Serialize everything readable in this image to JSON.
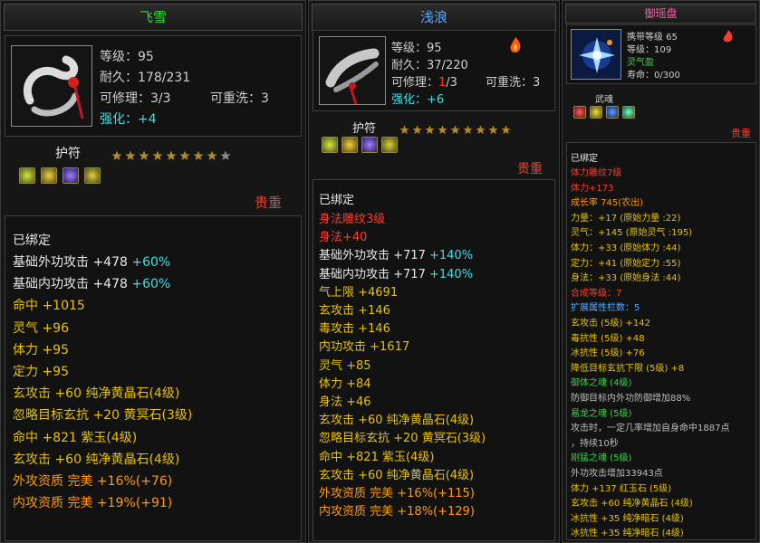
{
  "panel1": {
    "title": "飞雪",
    "level": "等级：95",
    "durability": "耐久：178/231",
    "repair": "可修理：3/3",
    "rewash": "可重洗：3",
    "strengthen_label": "强化：",
    "strengthen_value": "+4",
    "amulet_label": "护符",
    "rarity": "贵重",
    "bound": "已绑定",
    "stats": [
      {
        "text": "基础外功攻击 +478 ",
        "extra": "+60%",
        "color": "white"
      },
      {
        "text": "基础内功攻击 +478 ",
        "extra": "+60%",
        "color": "white"
      },
      {
        "text": "命中 +1015",
        "extra": "",
        "color": "gold"
      },
      {
        "text": "灵气 +96",
        "extra": "",
        "color": "gold"
      },
      {
        "text": "体力 +95",
        "extra": "",
        "color": "gold"
      },
      {
        "text": "定力 +95",
        "extra": "",
        "color": "gold"
      },
      {
        "text": "玄攻击 +60 纯净黄晶石(4级)",
        "extra": "",
        "color": "gold"
      },
      {
        "text": "忽略目标玄抗 +20 黄冥石(3级)",
        "extra": "",
        "color": "gold"
      },
      {
        "text": "命中 +821 紫玉(4级)",
        "extra": "",
        "color": "gold"
      },
      {
        "text": "玄攻击 +60 纯净黄晶石(4级)",
        "extra": "",
        "color": "gold"
      },
      {
        "text": "外攻资质  完美 +16%(+76)",
        "extra": "",
        "color": "orange"
      },
      {
        "text": "内攻资质  完美 +19%(+91)",
        "extra": "",
        "color": "orange"
      }
    ]
  },
  "panel2": {
    "title": "浅浪",
    "level": "等级：95",
    "durability_prefix": "耐久：",
    "durability_value": "37/220",
    "repair_prefix": "可修理：",
    "repair_value": "1",
    "repair_suffix": "/3",
    "rewash": "可重洗：3",
    "strengthen_label": "强化：",
    "strengthen_value": "+6",
    "amulet_label": "护符",
    "rarity": "贵重",
    "bound": "已绑定",
    "stats": [
      {
        "text": "身法雕纹3级",
        "extra": "",
        "color": "red"
      },
      {
        "text": "身法+40",
        "extra": "",
        "color": "red"
      },
      {
        "text": "基础外功攻击 +717 ",
        "extra": "+140%",
        "color": "white"
      },
      {
        "text": "基础内功攻击 +717 ",
        "extra": "+140%",
        "color": "white"
      },
      {
        "text": "气上限 +4691",
        "extra": "",
        "color": "gold"
      },
      {
        "text": "玄攻击 +146",
        "extra": "",
        "color": "gold"
      },
      {
        "text": "毒攻击 +146",
        "extra": "",
        "color": "gold"
      },
      {
        "text": "内功攻击 +1617",
        "extra": "",
        "color": "gold"
      },
      {
        "text": "灵气 +85",
        "extra": "",
        "color": "gold"
      },
      {
        "text": "体力 +84",
        "extra": "",
        "color": "gold"
      },
      {
        "text": "身法 +46",
        "extra": "",
        "color": "gold"
      },
      {
        "text": "玄攻击 +60 纯净黄晶石(4级)",
        "extra": "",
        "color": "gold"
      },
      {
        "text": "忽略目标玄抗 +20 黄冥石(3级)",
        "extra": "",
        "color": "gold"
      },
      {
        "text": "命中 +821 紫玉(4级)",
        "extra": "",
        "color": "gold"
      },
      {
        "text": "玄攻击 +60 纯净黄晶石(4级)",
        "extra": "",
        "color": "gold"
      },
      {
        "text": "外攻资质  完美 +16%(+115)",
        "extra": "",
        "color": "orange"
      },
      {
        "text": "内攻资质  完美 +18%(+129)",
        "extra": "",
        "color": "orange"
      }
    ]
  },
  "panel3": {
    "title": "御瑶盘",
    "carry_level": "携带等级 65",
    "level": "等级：109",
    "spirit": "灵气盈",
    "life": "寿命：0/300",
    "soul_label": "武魂",
    "rarity": "贵重",
    "bound": "已绑定",
    "stats": [
      {
        "text": "体力雕纹7级",
        "color": "red"
      },
      {
        "text": "体力+173",
        "color": "red"
      },
      {
        "text": "成长率 745(农出)",
        "color": "orange"
      },
      {
        "text": "力量：+17 (原始力量 :22)",
        "color": "gold"
      },
      {
        "text": "灵气：+145 (原始灵气 :195)",
        "color": "gold"
      },
      {
        "text": "体力：+33 (原始体力 :44)",
        "color": "gold"
      },
      {
        "text": "定力：+41 (原始定力 :55)",
        "color": "gold"
      },
      {
        "text": "身法：+33 (原始身法 :44)",
        "color": "gold"
      },
      {
        "text": "合成等级：7",
        "color": "red"
      },
      {
        "text": "扩展属性栏数：5",
        "color": "blue"
      },
      {
        "text": "玄攻击 (5级) +142",
        "color": "gold"
      },
      {
        "text": "毒抗性 (5级) +48",
        "color": "gold"
      },
      {
        "text": "冰抗性 (5级) +76",
        "color": "gold"
      },
      {
        "text": "降低目标玄抗下限 (5级) +8",
        "color": "gold"
      },
      {
        "text": "御体之魂 (4级)",
        "color": "green"
      },
      {
        "text": "防御目标内外功防御增加88%",
        "color": "gray"
      },
      {
        "text": "易龙之魂 (5级)",
        "color": "green"
      },
      {
        "text": "攻击时，一定几率增加自身命中1887点",
        "color": "gray"
      },
      {
        "text": "，持续10秒",
        "color": "gray"
      },
      {
        "text": "刚猛之魂 (5级)",
        "color": "green"
      },
      {
        "text": "外功攻击增加33943点",
        "color": "gray"
      },
      {
        "text": "体力 +137 红玉石 (5级)",
        "color": "gold"
      },
      {
        "text": "玄攻击 +60 纯净黄晶石 (4级)",
        "color": "gold"
      },
      {
        "text": "冰抗性 +35 纯净暗石 (4级)",
        "color": "gold"
      },
      {
        "text": "冰抗性 +35 纯净暗石 (4级)",
        "color": "gold"
      }
    ]
  },
  "colors": {
    "gold": "#e6c200",
    "white": "#e8e8e8",
    "cyan": "#3ee0e0",
    "red": "#ff3a2a",
    "orange": "#ff9a00",
    "green": "#3fd14a",
    "blue": "#5aa8ff",
    "gray": "#bdbdbd"
  },
  "stars": {
    "panel1_filled": 8,
    "panel1_total": 9,
    "panel2_filled": 9,
    "panel2_total": 9
  }
}
